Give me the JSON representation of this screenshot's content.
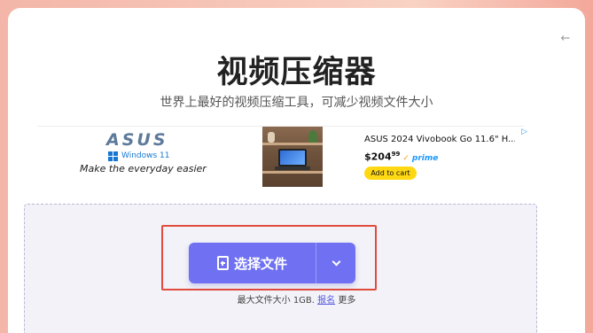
{
  "header": {
    "title": "视频压缩器",
    "subtitle": "世界上最好的视频压缩工具，可减少视频文件大小"
  },
  "ad": {
    "brand": "ASUS",
    "os_label": "Windows 11",
    "tagline": "Make the everyday easier",
    "product_name": "ASUS 2024 Vivobook Go 11.6\" H...",
    "price": "$204",
    "price_cents": "99",
    "prime_label": "prime",
    "add_to_cart_label": "Add to cart"
  },
  "upload": {
    "button_label": "选择文件",
    "limit_prefix": "最大文件大小 1GB.",
    "signup_link": "报名",
    "limit_suffix": "更多"
  },
  "colors": {
    "primary": "#7071f2",
    "highlight": "#e24b3b",
    "dropzone_bg": "#f2f2f8"
  }
}
